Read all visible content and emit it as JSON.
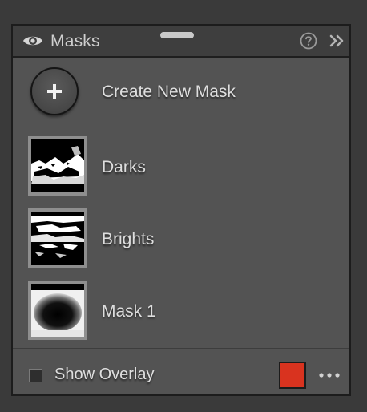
{
  "panel": {
    "title": "Masks",
    "icons": {
      "visibility": "eye-icon",
      "help": "question-circle-icon",
      "collapse": "double-chevron-right-icon",
      "drag": "drag-handle"
    }
  },
  "create_mask": {
    "label": "Create New Mask",
    "icon": "plus-icon"
  },
  "masks": [
    {
      "label": "Darks"
    },
    {
      "label": "Brights"
    },
    {
      "label": "Mask 1"
    }
  ],
  "footer": {
    "show_overlay_label": "Show Overlay",
    "show_overlay_checked": false,
    "overlay_color": "#d9331f",
    "more_icon": "more-horizontal-icon"
  },
  "colors": {
    "panel_bg": "#535353",
    "header_bg": "#3e3e3e",
    "text": "#dedede",
    "accent": "#d9331f"
  }
}
